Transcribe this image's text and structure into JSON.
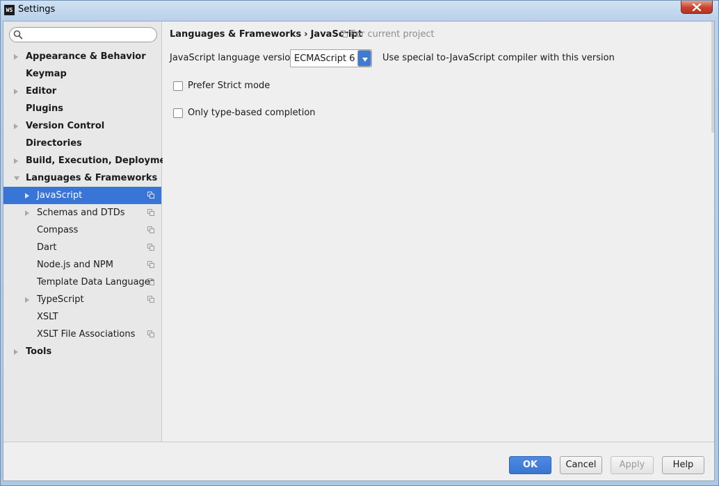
{
  "window": {
    "icon_text": "WS",
    "title": "Settings"
  },
  "search": {
    "placeholder": "",
    "value": ""
  },
  "sidebar": {
    "items": [
      {
        "label": "Appearance & Behavior"
      },
      {
        "label": "Keymap"
      },
      {
        "label": "Editor"
      },
      {
        "label": "Plugins"
      },
      {
        "label": "Version Control"
      },
      {
        "label": "Directories"
      },
      {
        "label": "Build, Execution, Deployment"
      },
      {
        "label": "Languages & Frameworks"
      },
      {
        "label": "JavaScript"
      },
      {
        "label": "Schemas and DTDs"
      },
      {
        "label": "Compass"
      },
      {
        "label": "Dart"
      },
      {
        "label": "Node.js and NPM"
      },
      {
        "label": "Template Data Languages"
      },
      {
        "label": "TypeScript"
      },
      {
        "label": "XSLT"
      },
      {
        "label": "XSLT File Associations"
      },
      {
        "label": "Tools"
      }
    ]
  },
  "breadcrumb": {
    "parent": "Languages & Frameworks",
    "separator": "›",
    "current": "JavaScript",
    "scope": "For current project"
  },
  "settings": {
    "version_label": "JavaScript language version",
    "version_value": "ECMAScript 6",
    "version_hint": "Use special to-JavaScript compiler with this version",
    "strict_mode_label": "Prefer Strict mode",
    "type_completion_label": "Only type-based completion"
  },
  "buttons": {
    "ok": "OK",
    "cancel": "Cancel",
    "apply": "Apply",
    "help": "Help"
  },
  "colors": {
    "selection": "#3875d6",
    "accent": "#3d7bd6"
  }
}
